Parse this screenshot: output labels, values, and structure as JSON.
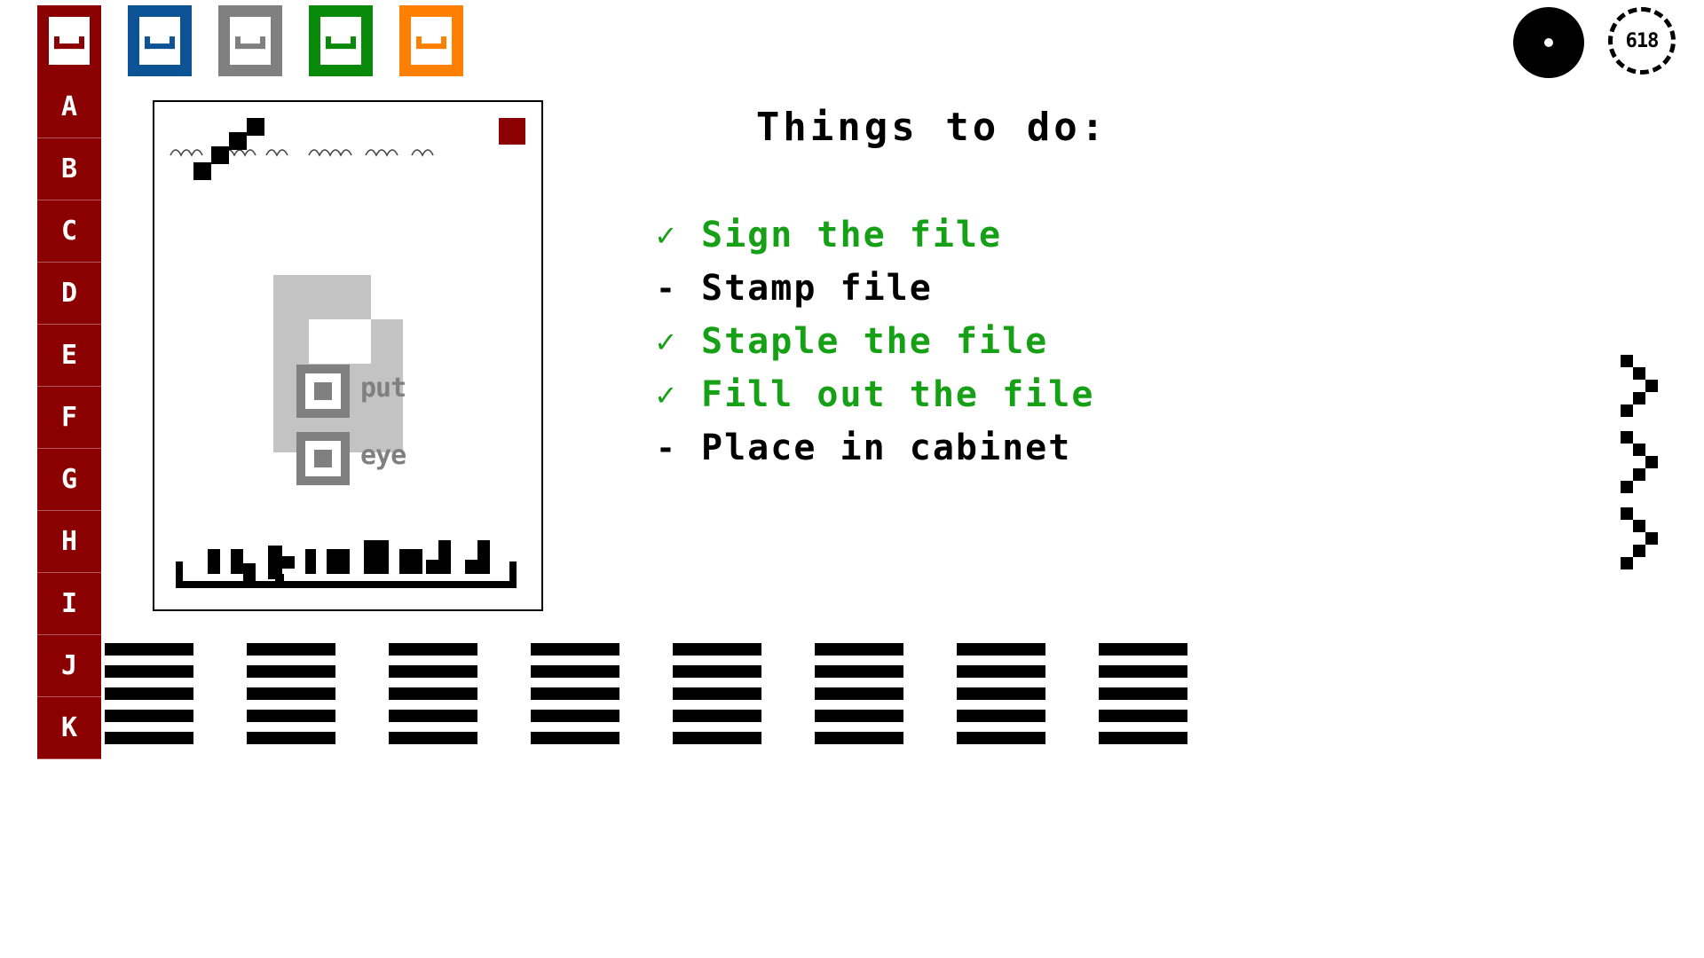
{
  "tabs": [
    {
      "name": "tab-red",
      "color": "#8b0000",
      "selected": true,
      "icon": "tray-icon"
    },
    {
      "name": "tab-blue",
      "color": "#0b5394",
      "selected": false,
      "icon": "tray-icon"
    },
    {
      "name": "tab-gray",
      "color": "#808080",
      "selected": false,
      "icon": "tray-icon"
    },
    {
      "name": "tab-green",
      "color": "#0a8a0a",
      "selected": false,
      "icon": "tray-icon"
    },
    {
      "name": "tab-orange",
      "color": "#ff8000",
      "selected": false,
      "icon": "tray-icon"
    }
  ],
  "sidebar": {
    "color": "#8b0000",
    "items": [
      {
        "label": "A"
      },
      {
        "label": "B"
      },
      {
        "label": "C"
      },
      {
        "label": "D"
      },
      {
        "label": "E"
      },
      {
        "label": "F"
      },
      {
        "label": "G"
      },
      {
        "label": "H"
      },
      {
        "label": "I"
      },
      {
        "label": "J"
      },
      {
        "label": "K"
      }
    ]
  },
  "document": {
    "stamp_color": "#8b0000",
    "watermark": {
      "checkbox_labels": [
        "put",
        "eye"
      ],
      "color": "#808080"
    },
    "signature_present": true
  },
  "todo": {
    "title": "Things to do:",
    "done_color": "#16a016",
    "open_color": "#000000",
    "done_marker": "✓",
    "open_marker": "-",
    "items": [
      {
        "label": "Sign the file",
        "done": true
      },
      {
        "label": "Stamp file",
        "done": false
      },
      {
        "label": "Staple the file",
        "done": true
      },
      {
        "label": "Fill out the file",
        "done": true
      },
      {
        "label": "Place in cabinet",
        "done": false
      }
    ]
  },
  "toolbar": {
    "ink_pad": {
      "name": "ink-pad",
      "color": "#000000"
    },
    "timer": {
      "value": "618"
    }
  },
  "chevrons": [
    {
      "name": "chevron-right-1"
    },
    {
      "name": "chevron-right-2"
    },
    {
      "name": "chevron-right-3"
    }
  ],
  "file_stacks": [
    {
      "bars": 5
    },
    {
      "bars": 5
    },
    {
      "bars": 5
    },
    {
      "bars": 5
    },
    {
      "bars": 5
    },
    {
      "bars": 5
    },
    {
      "bars": 5
    },
    {
      "bars": 5
    }
  ]
}
